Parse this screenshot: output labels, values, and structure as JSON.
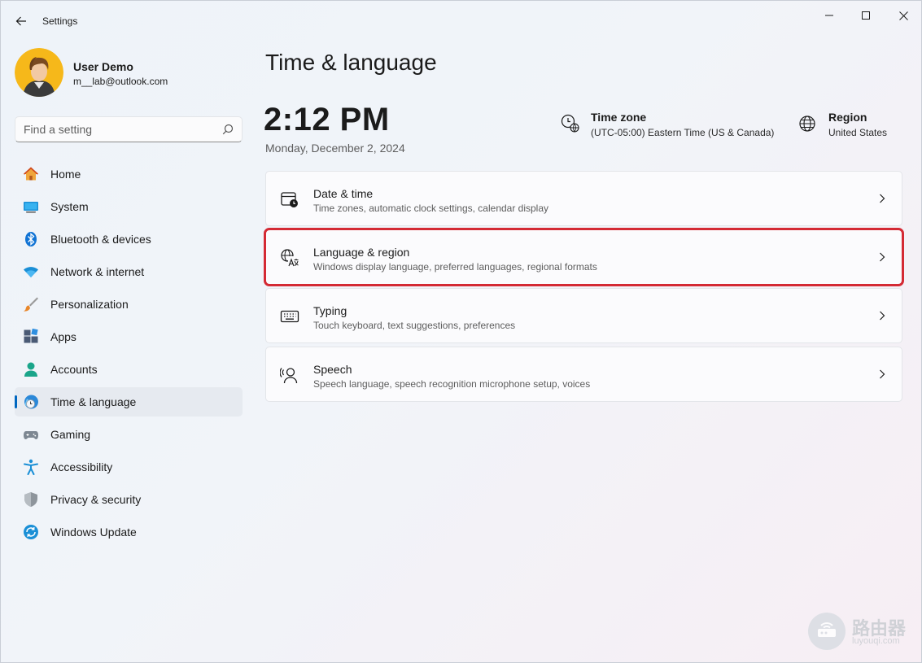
{
  "window": {
    "title": "Settings"
  },
  "profile": {
    "name": "User Demo",
    "email": "m__lab@outlook.com"
  },
  "search": {
    "placeholder": "Find a setting"
  },
  "sidebar": {
    "items": [
      {
        "label": "Home",
        "icon": "home-icon"
      },
      {
        "label": "System",
        "icon": "system-icon"
      },
      {
        "label": "Bluetooth & devices",
        "icon": "bluetooth-icon"
      },
      {
        "label": "Network & internet",
        "icon": "wifi-icon"
      },
      {
        "label": "Personalization",
        "icon": "brush-icon"
      },
      {
        "label": "Apps",
        "icon": "apps-icon"
      },
      {
        "label": "Accounts",
        "icon": "accounts-icon"
      },
      {
        "label": "Time & language",
        "icon": "time-language-icon",
        "active": true
      },
      {
        "label": "Gaming",
        "icon": "gamepad-icon"
      },
      {
        "label": "Accessibility",
        "icon": "accessibility-icon"
      },
      {
        "label": "Privacy & security",
        "icon": "shield-icon"
      },
      {
        "label": "Windows Update",
        "icon": "update-icon"
      }
    ]
  },
  "main": {
    "title": "Time & language",
    "clock": "2:12 PM",
    "date": "Monday, December 2, 2024",
    "timezone": {
      "label": "Time zone",
      "value": "(UTC-05:00) Eastern Time (US & Canada)"
    },
    "region": {
      "label": "Region",
      "value": "United States"
    },
    "cards": [
      {
        "title": "Date & time",
        "desc": "Time zones, automatic clock settings, calendar display",
        "icon": "calendar-clock-icon"
      },
      {
        "title": "Language & region",
        "desc": "Windows display language, preferred languages, regional formats",
        "icon": "language-icon",
        "highlighted": true
      },
      {
        "title": "Typing",
        "desc": "Touch keyboard, text suggestions, preferences",
        "icon": "keyboard-icon"
      },
      {
        "title": "Speech",
        "desc": "Speech language, speech recognition microphone setup, voices",
        "icon": "speech-icon"
      }
    ]
  },
  "watermark": {
    "text": "路由器",
    "sub": "luyouqi.com"
  },
  "colors": {
    "accent": "#0067c0",
    "highlight": "#d42a34"
  }
}
